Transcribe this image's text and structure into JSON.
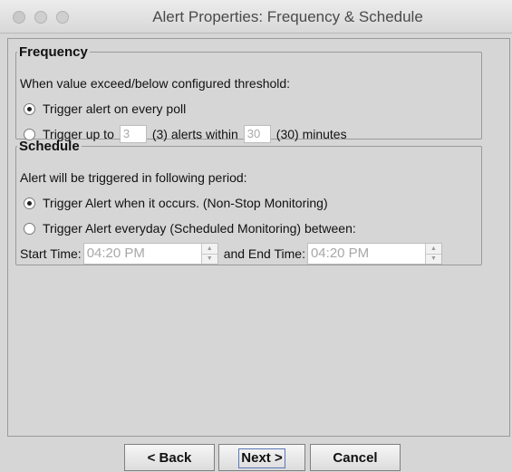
{
  "window": {
    "title": "Alert Properties: Frequency & Schedule"
  },
  "frequency": {
    "legend": "Frequency",
    "description": "When value exceed/below configured threshold:",
    "option_every_poll": "Trigger alert on every poll",
    "option_up_to_prefix": "Trigger up to",
    "alerts_value": "3",
    "alerts_default_text": "(3) alerts within",
    "minutes_value": "30",
    "minutes_default_text": "(30) minutes",
    "selected": "every_poll"
  },
  "schedule": {
    "legend": "Schedule",
    "description": "Alert will be triggered in following period:",
    "option_non_stop": "Trigger Alert when it occurs. (Non-Stop Monitoring)",
    "option_scheduled": "Trigger Alert everyday (Scheduled Monitoring) between:",
    "start_label": "Start Time:",
    "start_value": "04:20 PM",
    "end_label": "and End Time:",
    "end_value": "04:20 PM",
    "selected": "non_stop"
  },
  "buttons": {
    "back": "< Back",
    "next": "Next >",
    "cancel": "Cancel"
  },
  "icons": {
    "spin_up": "▲",
    "spin_down": "▼"
  }
}
